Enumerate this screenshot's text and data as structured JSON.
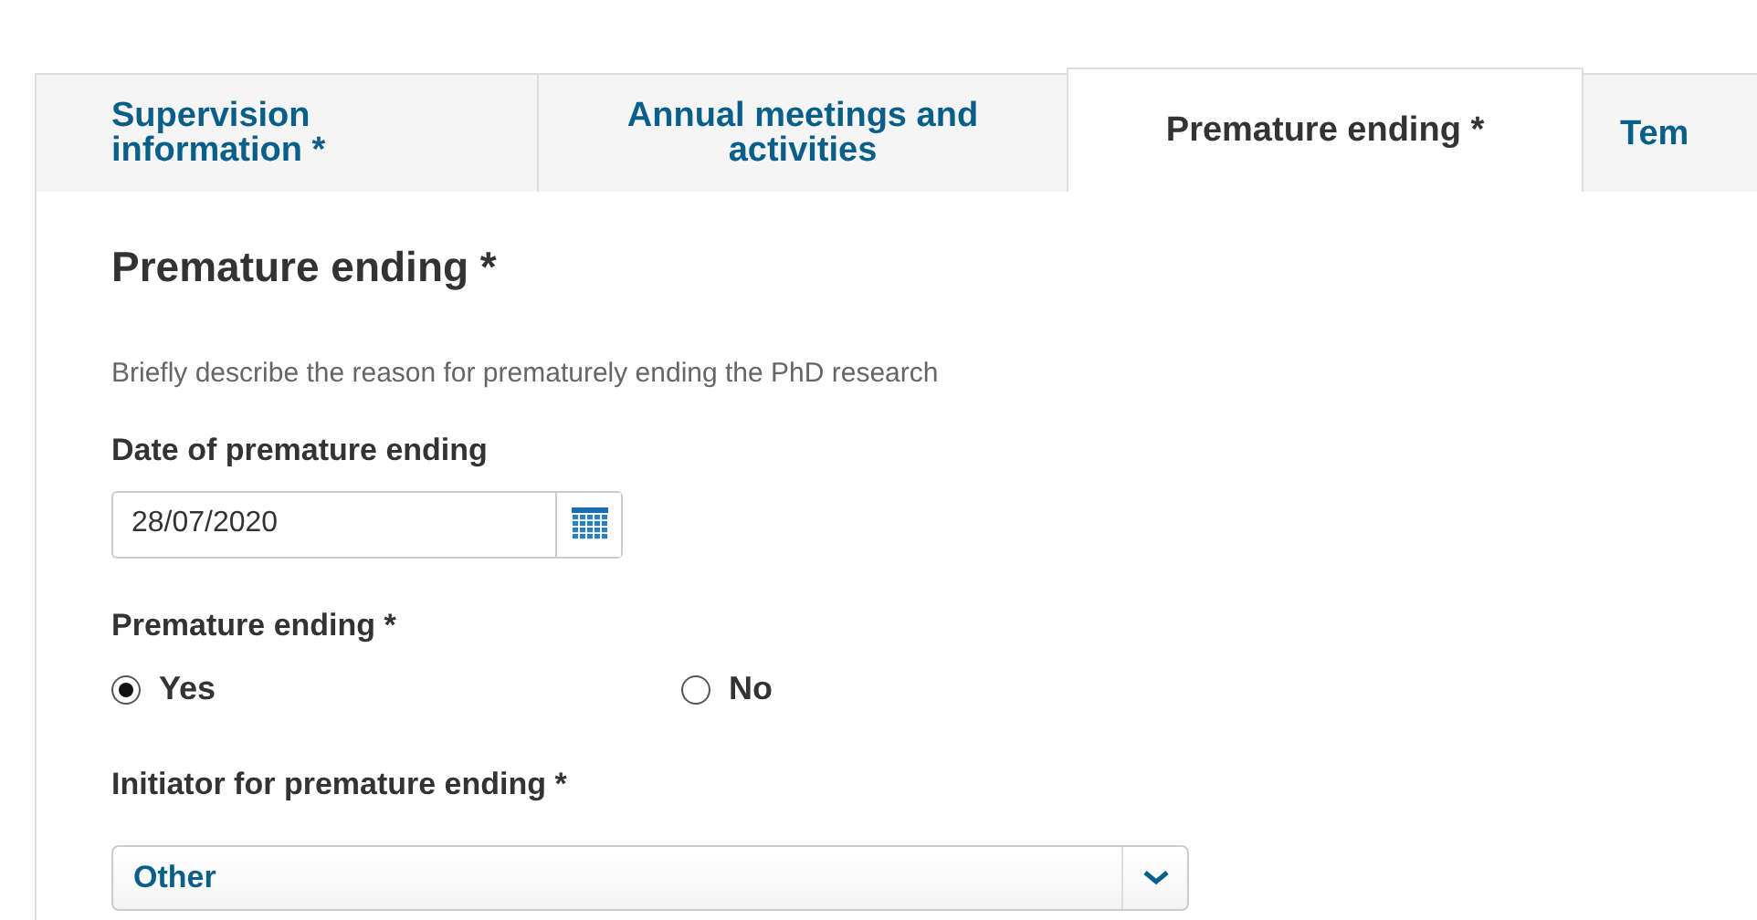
{
  "tabs": [
    {
      "label": "Supervision information *",
      "selected": false
    },
    {
      "label": "Annual meetings and activities",
      "selected": false
    },
    {
      "label": "Premature ending *",
      "selected": true
    },
    {
      "label": "Tem",
      "selected": false
    }
  ],
  "section": {
    "title": "Premature ending *",
    "description": "Briefly describe the reason for prematurely ending the PhD research"
  },
  "date_field": {
    "label": "Date of premature ending",
    "value": "28/07/2020"
  },
  "radio_group": {
    "label": "Premature ending *",
    "options": [
      {
        "label": "Yes",
        "selected": true
      },
      {
        "label": "No",
        "selected": false
      }
    ]
  },
  "initiator": {
    "label": "Initiator for premature ending *",
    "value": "Other"
  }
}
